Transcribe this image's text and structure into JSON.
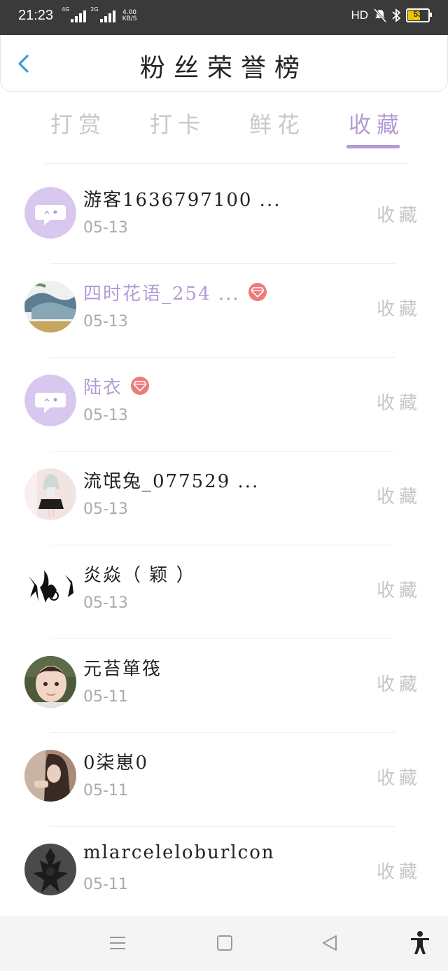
{
  "status_bar": {
    "time": "21:23",
    "net1": "4G",
    "net2": "2G",
    "speed_value": "4.00",
    "speed_unit": "KB/S",
    "hd": "HD",
    "battery": "53"
  },
  "header": {
    "title": "粉丝荣誉榜"
  },
  "tabs": [
    {
      "label": "打赏",
      "active": false
    },
    {
      "label": "打卡",
      "active": false
    },
    {
      "label": "鲜花",
      "active": false
    },
    {
      "label": "收藏",
      "active": true
    }
  ],
  "list": [
    {
      "name": "游客1636797100 ...",
      "date": "05-13",
      "action": "收藏",
      "vip": false,
      "avatar": "default-chat-avatar"
    },
    {
      "name": "四时花语_254 ...",
      "date": "05-13",
      "action": "收藏",
      "vip": true,
      "avatar": "landscape-avatar"
    },
    {
      "name": "陆衣",
      "date": "05-13",
      "action": "收藏",
      "vip": true,
      "avatar": "default-chat-avatar"
    },
    {
      "name": "流氓兔_077529 ...",
      "date": "05-13",
      "action": "收藏",
      "vip": false,
      "avatar": "anime-girl-avatar"
    },
    {
      "name": "炎焱（ 颖 ）",
      "date": "05-13",
      "action": "收藏",
      "vip": false,
      "avatar": "ink-figures-avatar"
    },
    {
      "name": "元苔箪筏",
      "date": "05-11",
      "action": "收藏",
      "vip": false,
      "avatar": "child-photo-avatar"
    },
    {
      "name": "0柒崽0",
      "date": "05-11",
      "action": "收藏",
      "vip": false,
      "avatar": "girl-photo-avatar"
    },
    {
      "name": "mlarceleloburlcon",
      "date": "05-11",
      "action": "收藏",
      "vip": false,
      "avatar": "dark-statue-avatar"
    }
  ],
  "colors": {
    "accent": "#b39ad6",
    "vip_badge": "#f07a7a",
    "back_arrow": "#3a9bd9"
  }
}
